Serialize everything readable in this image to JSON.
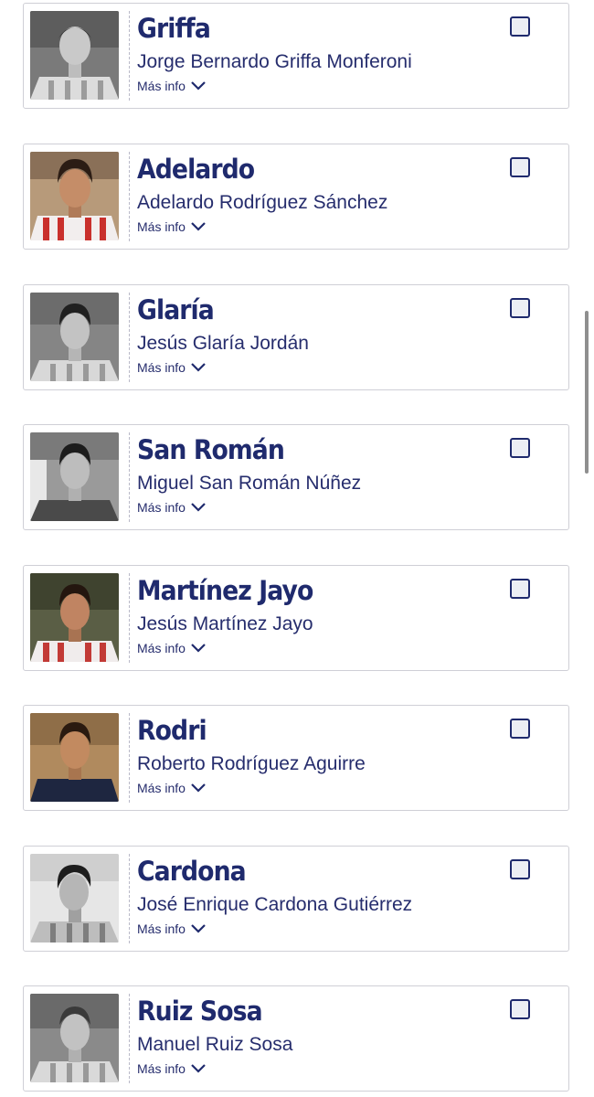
{
  "players": [
    {
      "alias": "Griffa",
      "full_name": "Jorge Bernardo Griffa Monferoni",
      "more_label": "Más info"
    },
    {
      "alias": "Adelardo",
      "full_name": "Adelardo Rodríguez Sánchez",
      "more_label": "Más info"
    },
    {
      "alias": "Glaría",
      "full_name": "Jesús Glaría Jordán",
      "more_label": "Más info"
    },
    {
      "alias": "San Román",
      "full_name": "Miguel San Román Núñez",
      "more_label": "Más info"
    },
    {
      "alias": "Martínez Jayo",
      "full_name": "Jesús Martínez Jayo",
      "more_label": "Más info"
    },
    {
      "alias": "Rodri",
      "full_name": "Roberto Rodríguez Aguirre",
      "more_label": "Más info"
    },
    {
      "alias": "Cardona",
      "full_name": "José Enrique Cardona Gutiérrez",
      "more_label": "Más info"
    },
    {
      "alias": "Ruiz Sosa",
      "full_name": "Manuel Ruiz Sosa",
      "more_label": "Más info"
    }
  ],
  "colors": {
    "title": "#1f2a6d",
    "text": "#262d6d",
    "border": "#cfcfd6"
  },
  "icons": {
    "expand": "chevron-down-icon"
  }
}
